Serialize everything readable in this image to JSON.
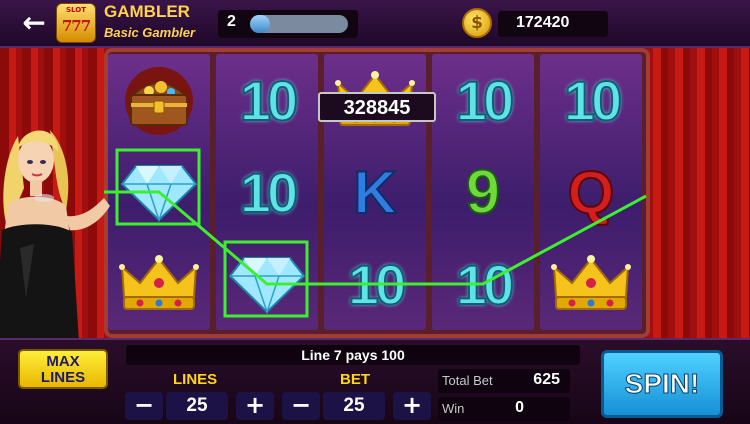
{
  "header": {
    "back_label": "back",
    "game_icon_text": "SLOT",
    "game_icon_number": "777",
    "title": "GAMBLER",
    "rank": "Basic Gambler",
    "level": "2",
    "xp_progress": 0.2,
    "coins": "172420"
  },
  "jackpot": "328845",
  "reels": [
    [
      "treasure-chest",
      "diamond",
      "crown"
    ],
    [
      "10",
      "10",
      "diamond"
    ],
    [
      "crown",
      "K",
      "10"
    ],
    [
      "10",
      "9",
      "10"
    ],
    [
      "10",
      "Q",
      "crown"
    ]
  ],
  "symbols": {
    "ten": "10",
    "king": "K",
    "nine": "9",
    "queen": "Q"
  },
  "win_line": {
    "line_number": 7,
    "highlighted": [
      [
        0,
        1
      ],
      [
        1,
        2
      ],
      [
        2,
        2
      ],
      [
        3,
        2
      ]
    ],
    "color": "#3cf02f"
  },
  "controls": {
    "max_lines": "MAX LINES",
    "max_lines_1": "MAX",
    "max_lines_2": "LINES",
    "payline_message": "Line 7 pays 100",
    "lines_label": "LINES",
    "lines_value": "25",
    "bet_label": "BET",
    "bet_value": "25",
    "minus": "−",
    "plus": "+",
    "total_bet_label": "Total Bet",
    "total_bet_value": "625",
    "win_label": "Win",
    "win_value": "0",
    "spin": "SPIN!"
  },
  "colors": {
    "accent_gold": "#ffd34a",
    "spin_blue": "#2bb4f0",
    "win_green": "#3cf02f",
    "curtain_red": "#c81a14"
  }
}
